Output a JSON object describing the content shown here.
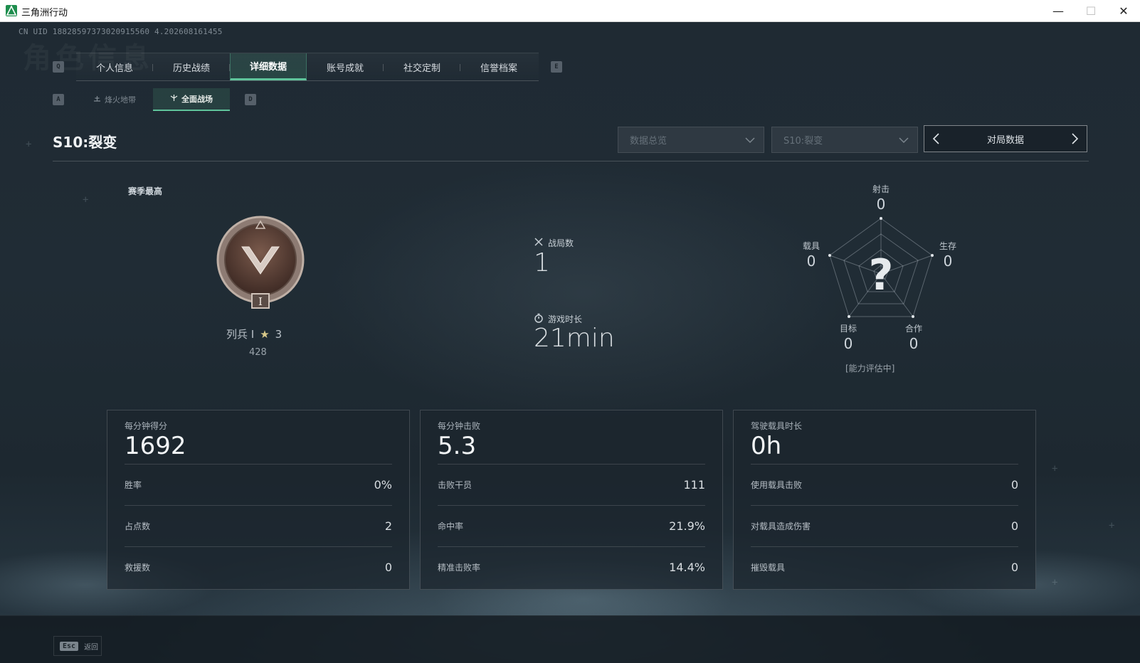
{
  "window": {
    "title": "三角洲行动",
    "controls": {
      "minimize": "—",
      "maximize": "☐",
      "close": "✕"
    }
  },
  "uid": "CN UID 18828597373020915560 4.202608161455",
  "ghost_title": "角色信息",
  "main_tabs": {
    "left_key": "Q",
    "right_key": "E",
    "items": [
      {
        "label": "个人信息",
        "active": false
      },
      {
        "label": "历史战绩",
        "active": false
      },
      {
        "label": "详细数据",
        "active": true
      },
      {
        "label": "账号成就",
        "active": false
      },
      {
        "label": "社交定制",
        "active": false
      },
      {
        "label": "信誉档案",
        "active": false
      }
    ]
  },
  "sub_tabs": {
    "left_key": "A",
    "right_key": "D",
    "items": [
      {
        "label": "烽火地带",
        "icon": "bonfire-icon",
        "active": false
      },
      {
        "label": "全面战场",
        "icon": "battlefield-icon",
        "active": true
      }
    ]
  },
  "season": {
    "title": "S10:裂变"
  },
  "filters": {
    "data_overview": "数据总览",
    "season_select": "S10:裂变",
    "pager_label": "对局数据"
  },
  "rank": {
    "heading": "赛季最高",
    "name": "列兵 I",
    "stars": "3",
    "points": "428",
    "tier_numeral": "I"
  },
  "mid_stats": {
    "matches_label": "战局数",
    "matches_value": "1",
    "playtime_label": "游戏时长",
    "playtime_value": "21min"
  },
  "radar": {
    "center": "?",
    "axes": [
      {
        "label": "射击",
        "value": "0"
      },
      {
        "label": "生存",
        "value": "0"
      },
      {
        "label": "合作",
        "value": "0"
      },
      {
        "label": "目标",
        "value": "0"
      },
      {
        "label": "载具",
        "value": "0"
      }
    ],
    "status": "[能力评估中]"
  },
  "panels": [
    {
      "headline_label": "每分钟得分",
      "headline_value": "1692",
      "rows": [
        {
          "label": "胜率",
          "value": "0%"
        },
        {
          "label": "占点数",
          "value": "2"
        },
        {
          "label": "救援数",
          "value": "0"
        }
      ]
    },
    {
      "headline_label": "每分钟击败",
      "headline_value": "5.3",
      "rows": [
        {
          "label": "击败干员",
          "value": "111"
        },
        {
          "label": "命中率",
          "value": "21.9%"
        },
        {
          "label": "精准击败率",
          "value": "14.4%"
        }
      ]
    },
    {
      "headline_label": "驾驶载具时长",
      "headline_value": "0h",
      "rows": [
        {
          "label": "使用载具击败",
          "value": "0"
        },
        {
          "label": "对载具造成伤害",
          "value": "0"
        },
        {
          "label": "摧毁载具",
          "value": "0"
        }
      ]
    }
  ],
  "footer": {
    "esc_key": "Esc",
    "back_label": "返回"
  },
  "colors": {
    "accent": "#5fc49b",
    "background": "#1b242c"
  }
}
